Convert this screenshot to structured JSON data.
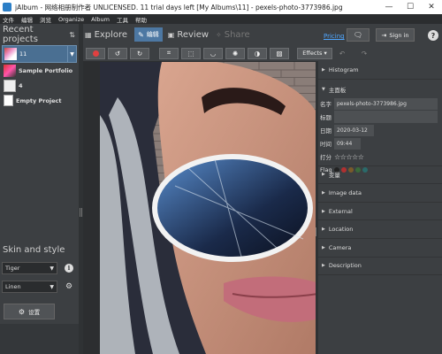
{
  "window": {
    "title": "jAlbum - 网络相册制作者 UNLICENSED. 11 trial days left [My Albums\\11] - pexels-photo-3773986.jpg",
    "minimize": "—",
    "maximize": "☐",
    "close": "✕"
  },
  "menu": [
    "文件",
    "编辑",
    "浏览",
    "Organize",
    "Album",
    "工具",
    "帮助"
  ],
  "left": {
    "recent_title": "Recent projects",
    "sort_icon": "⇅",
    "projects": [
      {
        "name": "11",
        "selected": true
      },
      {
        "name": "Sample Portfolio"
      },
      {
        "name": "4"
      },
      {
        "name": "Empty Project"
      }
    ],
    "skin_title": "Skin and style",
    "skin_value": "Tiger",
    "style_value": "Linen",
    "settings_label": "设置"
  },
  "header": {
    "tabs": [
      {
        "label": "Explore",
        "icon": "▦"
      },
      {
        "label": "编辑",
        "icon": "✎",
        "active": true
      },
      {
        "label": "Review",
        "icon": "▣"
      },
      {
        "label": "Share",
        "icon": "✧",
        "disabled": true
      }
    ],
    "pricing": "Pricing",
    "notify_icon": "🗨",
    "signin": "Sign in",
    "signin_icon": "⇥",
    "help": "?"
  },
  "toolbar": {
    "tools": [
      "●",
      "↺",
      "↻",
      "⌗",
      "⬚",
      "◡",
      "✺",
      "◑",
      "▨"
    ],
    "effects": "Effects ▾",
    "undo": "↶",
    "redo": "↷"
  },
  "right": {
    "sections_top": [
      {
        "label": "Histogram"
      }
    ],
    "main_panel_title": "主面板",
    "fields": {
      "name_label": "名字",
      "name_value": "pexels-photo-3773986.jpg",
      "title_label": "标题",
      "title_value": "",
      "date_label": "日期",
      "date_value": "2020-03-12",
      "time_label": "时间",
      "time_value": "09:44",
      "rating_label": "打分",
      "rating_stars": "☆☆☆☆☆",
      "flag_label": "Flag"
    },
    "flag_colors": [
      "#222222",
      "#b03030",
      "#7a5a2a",
      "#3a6a3a",
      "#2a6a6a"
    ],
    "sections_bottom": [
      {
        "label": "变量"
      },
      {
        "label": "Image data"
      },
      {
        "label": "External"
      },
      {
        "label": "Location"
      },
      {
        "label": "Camera"
      },
      {
        "label": "Description"
      }
    ]
  },
  "colors": {
    "accent": "#4d78a3",
    "link": "#4fa6ff",
    "panel": "#3c3f42"
  }
}
